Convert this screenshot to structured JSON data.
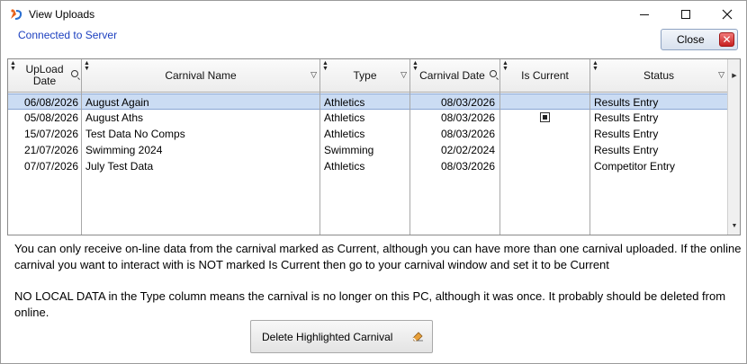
{
  "window": {
    "title": "View Uploads",
    "connection_status": "Connected to Server",
    "close_label": "Close"
  },
  "table": {
    "columns": [
      {
        "key": "upload_date",
        "label": "UpLoad Date"
      },
      {
        "key": "carnival_name",
        "label": "Carnival Name"
      },
      {
        "key": "type",
        "label": "Type"
      },
      {
        "key": "carnival_date",
        "label": "Carnival Date"
      },
      {
        "key": "is_current",
        "label": "Is Current"
      },
      {
        "key": "status",
        "label": "Status"
      }
    ],
    "rows": [
      {
        "upload_date": "06/08/2026",
        "carnival_name": "August Again",
        "type": "Athletics",
        "carnival_date": "08/03/2026",
        "is_current": false,
        "status": "Results Entry",
        "selected": true
      },
      {
        "upload_date": "05/08/2026",
        "carnival_name": "August Aths",
        "type": "Athletics",
        "carnival_date": "08/03/2026",
        "is_current": true,
        "status": "Results Entry",
        "selected": false
      },
      {
        "upload_date": "15/07/2026",
        "carnival_name": "Test Data No Comps",
        "type": "Athletics",
        "carnival_date": "08/03/2026",
        "is_current": false,
        "status": "Results Entry",
        "selected": false
      },
      {
        "upload_date": "21/07/2026",
        "carnival_name": "Swimming 2024",
        "type": "Swimming",
        "carnival_date": "02/02/2024",
        "is_current": false,
        "status": "Results Entry",
        "selected": false
      },
      {
        "upload_date": "07/07/2026",
        "carnival_name": "July Test Data",
        "type": "Athletics",
        "carnival_date": "08/03/2026",
        "is_current": false,
        "status": "Competitor Entry",
        "selected": false
      }
    ]
  },
  "info": {
    "paragraph1": "You can only receive on-line data from the carnival marked as Current, although you can have more than one carnival uploaded.  If the online carnival you want to interact with is NOT marked Is Current then go to your carnival window and set it to be Current",
    "paragraph2": "NO LOCAL DATA in the Type column means the carnival is no longer on this PC, although it was once.  It probably should be deleted from online."
  },
  "actions": {
    "delete_label": "Delete Highlighted Carnival"
  },
  "colors": {
    "selected_row": "#cbdcf3",
    "connected_text": "#1b3fbf",
    "close_accent": "#c62020"
  }
}
